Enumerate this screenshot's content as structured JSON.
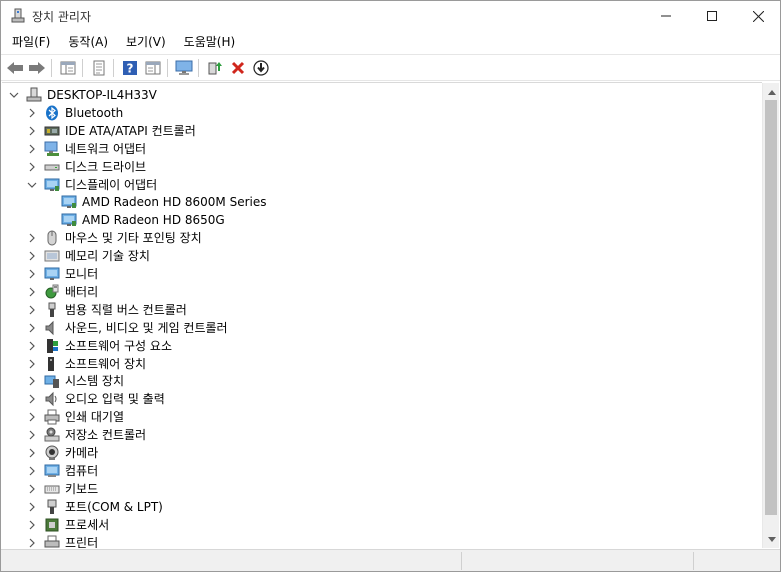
{
  "window": {
    "title": "장치 관리자",
    "minimize_glyph": "—",
    "maximize_glyph": "☐",
    "close_glyph": "✕"
  },
  "menu": {
    "items": [
      "파일(F)",
      "동작(A)",
      "보기(V)",
      "도움말(H)"
    ]
  },
  "toolbar": {
    "buttons": [
      "back-icon",
      "forward-icon",
      "show-hide-tree-icon",
      "properties-icon",
      "help-icon",
      "action-pane-icon",
      "scan-hardware-icon",
      "update-driver-icon",
      "uninstall-icon",
      "disable-device-icon"
    ]
  },
  "tree": {
    "root": "DESKTOP-IL4H33V",
    "items": [
      {
        "label": "Bluetooth",
        "icon": "bluetooth-icon",
        "expanded": false
      },
      {
        "label": "IDE ATA/ATAPI 컨트롤러",
        "icon": "ide-controller-icon",
        "expanded": false
      },
      {
        "label": "네트워크 어댑터",
        "icon": "network-adapter-icon",
        "expanded": false
      },
      {
        "label": "디스크 드라이브",
        "icon": "disk-drive-icon",
        "expanded": false
      },
      {
        "label": "디스플레이 어댑터",
        "icon": "display-adapter-icon",
        "expanded": true
      },
      {
        "label": "AMD Radeon HD 8600M Series",
        "icon": "display-adapter-icon",
        "child": true
      },
      {
        "label": "AMD Radeon HD 8650G",
        "icon": "display-adapter-icon",
        "child": true
      },
      {
        "label": "마우스 및 기타 포인팅 장치",
        "icon": "mouse-icon",
        "expanded": false
      },
      {
        "label": "메모리 기술 장치",
        "icon": "memory-device-icon",
        "expanded": false
      },
      {
        "label": "모니터",
        "icon": "monitor-icon",
        "expanded": false
      },
      {
        "label": "배터리",
        "icon": "battery-icon",
        "expanded": false
      },
      {
        "label": "범용 직렬 버스 컨트롤러",
        "icon": "usb-controller-icon",
        "expanded": false
      },
      {
        "label": "사운드, 비디오 및 게임 컨트롤러",
        "icon": "sound-icon",
        "expanded": false
      },
      {
        "label": "소프트웨어 구성 요소",
        "icon": "software-component-icon",
        "expanded": false
      },
      {
        "label": "소프트웨어 장치",
        "icon": "software-device-icon",
        "expanded": false
      },
      {
        "label": "시스템 장치",
        "icon": "system-device-icon",
        "expanded": false
      },
      {
        "label": "오디오 입력 및 출력",
        "icon": "audio-io-icon",
        "expanded": false
      },
      {
        "label": "인쇄 대기열",
        "icon": "print-queue-icon",
        "expanded": false
      },
      {
        "label": "저장소 컨트롤러",
        "icon": "storage-controller-icon",
        "expanded": false
      },
      {
        "label": "카메라",
        "icon": "camera-icon",
        "expanded": false
      },
      {
        "label": "컴퓨터",
        "icon": "computer-icon",
        "expanded": false
      },
      {
        "label": "키보드",
        "icon": "keyboard-icon",
        "expanded": false
      },
      {
        "label": "포트(COM & LPT)",
        "icon": "port-icon",
        "expanded": false
      },
      {
        "label": "프로세서",
        "icon": "processor-icon",
        "expanded": false
      },
      {
        "label": "프린터",
        "icon": "printer-icon",
        "expanded": false
      }
    ]
  }
}
